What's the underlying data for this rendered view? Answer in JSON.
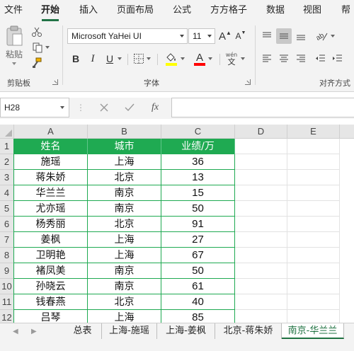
{
  "menu": {
    "tabs": [
      "文件",
      "开始",
      "插入",
      "页面布局",
      "公式",
      "方方格子",
      "数据",
      "视图",
      "帮"
    ],
    "active_index": 1
  },
  "ribbon": {
    "clipboard": {
      "paste_label": "粘贴",
      "group_label": "剪贴板"
    },
    "font": {
      "family": "Microsoft YaHei UI",
      "size": "11",
      "grow": "A",
      "shrink": "A",
      "bold": "B",
      "italic": "I",
      "underline": "U",
      "font_color_letter": "A",
      "phonetic_top": "wén",
      "phonetic_bottom": "文",
      "group_label": "字体"
    },
    "alignment": {
      "group_label": "对齐方式"
    }
  },
  "formula_bar": {
    "name_box": "H28",
    "fx": "fx",
    "value": ""
  },
  "grid": {
    "columns": [
      "A",
      "B",
      "C",
      "D",
      "E"
    ],
    "rows": [
      "1",
      "2",
      "3",
      "4",
      "5",
      "6",
      "7",
      "8",
      "9",
      "10",
      "11",
      "12"
    ],
    "header_row": [
      "姓名",
      "城市",
      "业绩/万"
    ],
    "data": [
      [
        "施瑶",
        "上海",
        "36"
      ],
      [
        "蒋朱娇",
        "北京",
        "13"
      ],
      [
        "华兰兰",
        "南京",
        "15"
      ],
      [
        "尤亦瑶",
        "南京",
        "50"
      ],
      [
        "杨秀丽",
        "北京",
        "91"
      ],
      [
        "姜枫",
        "上海",
        "27"
      ],
      [
        "卫明艳",
        "上海",
        "67"
      ],
      [
        "褚凤美",
        "南京",
        "50"
      ],
      [
        "孙晓云",
        "南京",
        "61"
      ],
      [
        "钱春燕",
        "北京",
        "40"
      ],
      [
        "吕琴",
        "上海",
        "85"
      ]
    ]
  },
  "sheets": {
    "tabs": [
      "总表",
      "上海-施瑶",
      "上海-姜枫",
      "北京-蒋朱娇",
      "南京-华兰兰"
    ],
    "active_index": 4
  },
  "colors": {
    "accent": "#217346",
    "table_header": "#1faa52",
    "table_border": "#1faa52"
  }
}
